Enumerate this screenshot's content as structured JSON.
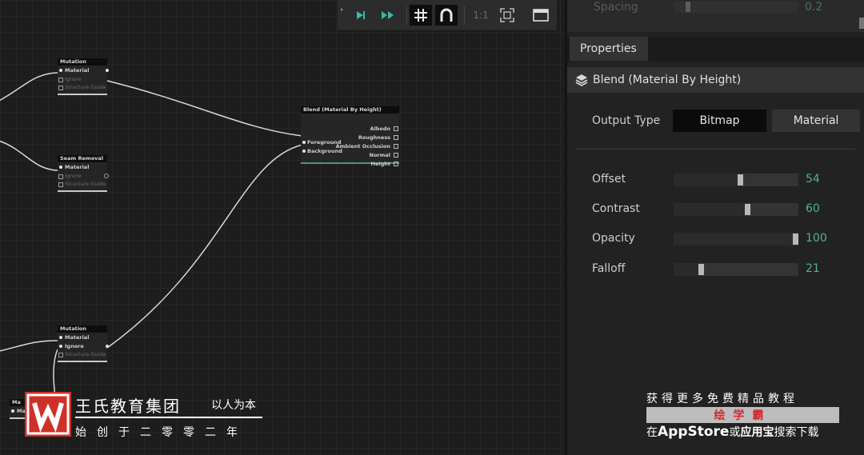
{
  "graph": {
    "nodes": {
      "mutation_top": {
        "title": "Mutation",
        "pins": [
          "Material",
          "Ignore",
          "Structure Guide"
        ]
      },
      "seam_removal": {
        "title": "Seam Removal",
        "pins": [
          "Material",
          "Ignore",
          "Structure Guide"
        ]
      },
      "mutation_bottom": {
        "title": "Mutation",
        "pins": [
          "Material",
          "Ignore",
          "Structure Guide"
        ]
      },
      "edge_node": {
        "title": "Ma",
        "pins": [
          "Ma"
        ]
      },
      "blend": {
        "title": "Blend (Material By Height)",
        "inputs": [
          "Foreground",
          "Background"
        ],
        "outputs": [
          "Albedo",
          "Roughness",
          "Ambient Occlusion",
          "Normal",
          "Height"
        ]
      }
    }
  },
  "toolbar": {
    "step_icon": "step-forward-icon",
    "play_icon": "fast-forward-icon",
    "grid_icon": "grid-icon",
    "snap_icon": "magnet-icon",
    "zoom_label": "1:1",
    "fit_icon": "fit-view-icon",
    "layout_icon": "window-icon"
  },
  "panel": {
    "spacing": {
      "label": "Spacing",
      "value": "0.2"
    },
    "properties_tab": "Properties",
    "node_title": "Blend (Material By Height)",
    "output_type": {
      "label": "Output Type",
      "options": [
        "Bitmap",
        "Material"
      ],
      "selected": "Bitmap"
    },
    "sliders": [
      {
        "label": "Offset",
        "value": "54",
        "fraction": 0.54
      },
      {
        "label": "Contrast",
        "value": "60",
        "fraction": 0.6
      },
      {
        "label": "Opacity",
        "value": "100",
        "fraction": 1.0
      },
      {
        "label": "Falloff",
        "value": "21",
        "fraction": 0.21
      }
    ]
  },
  "watermark": {
    "brand": "王氏教育集团",
    "slogan": "以人为本",
    "since": "始创于二零零二年",
    "promo_line1": "获得更多免费精品教程",
    "promo_app": "绘学霸",
    "promo_line3_pre": "在",
    "promo_appstore": "AppStore",
    "promo_or": "或",
    "promo_yyb": "应用宝",
    "promo_line3_post": "搜索下载"
  },
  "colors": {
    "accent": "#4fb0a3",
    "wire": "#d9d9d9",
    "selected_segment": "#0b0b0b",
    "logo_red": "#d0302a"
  }
}
